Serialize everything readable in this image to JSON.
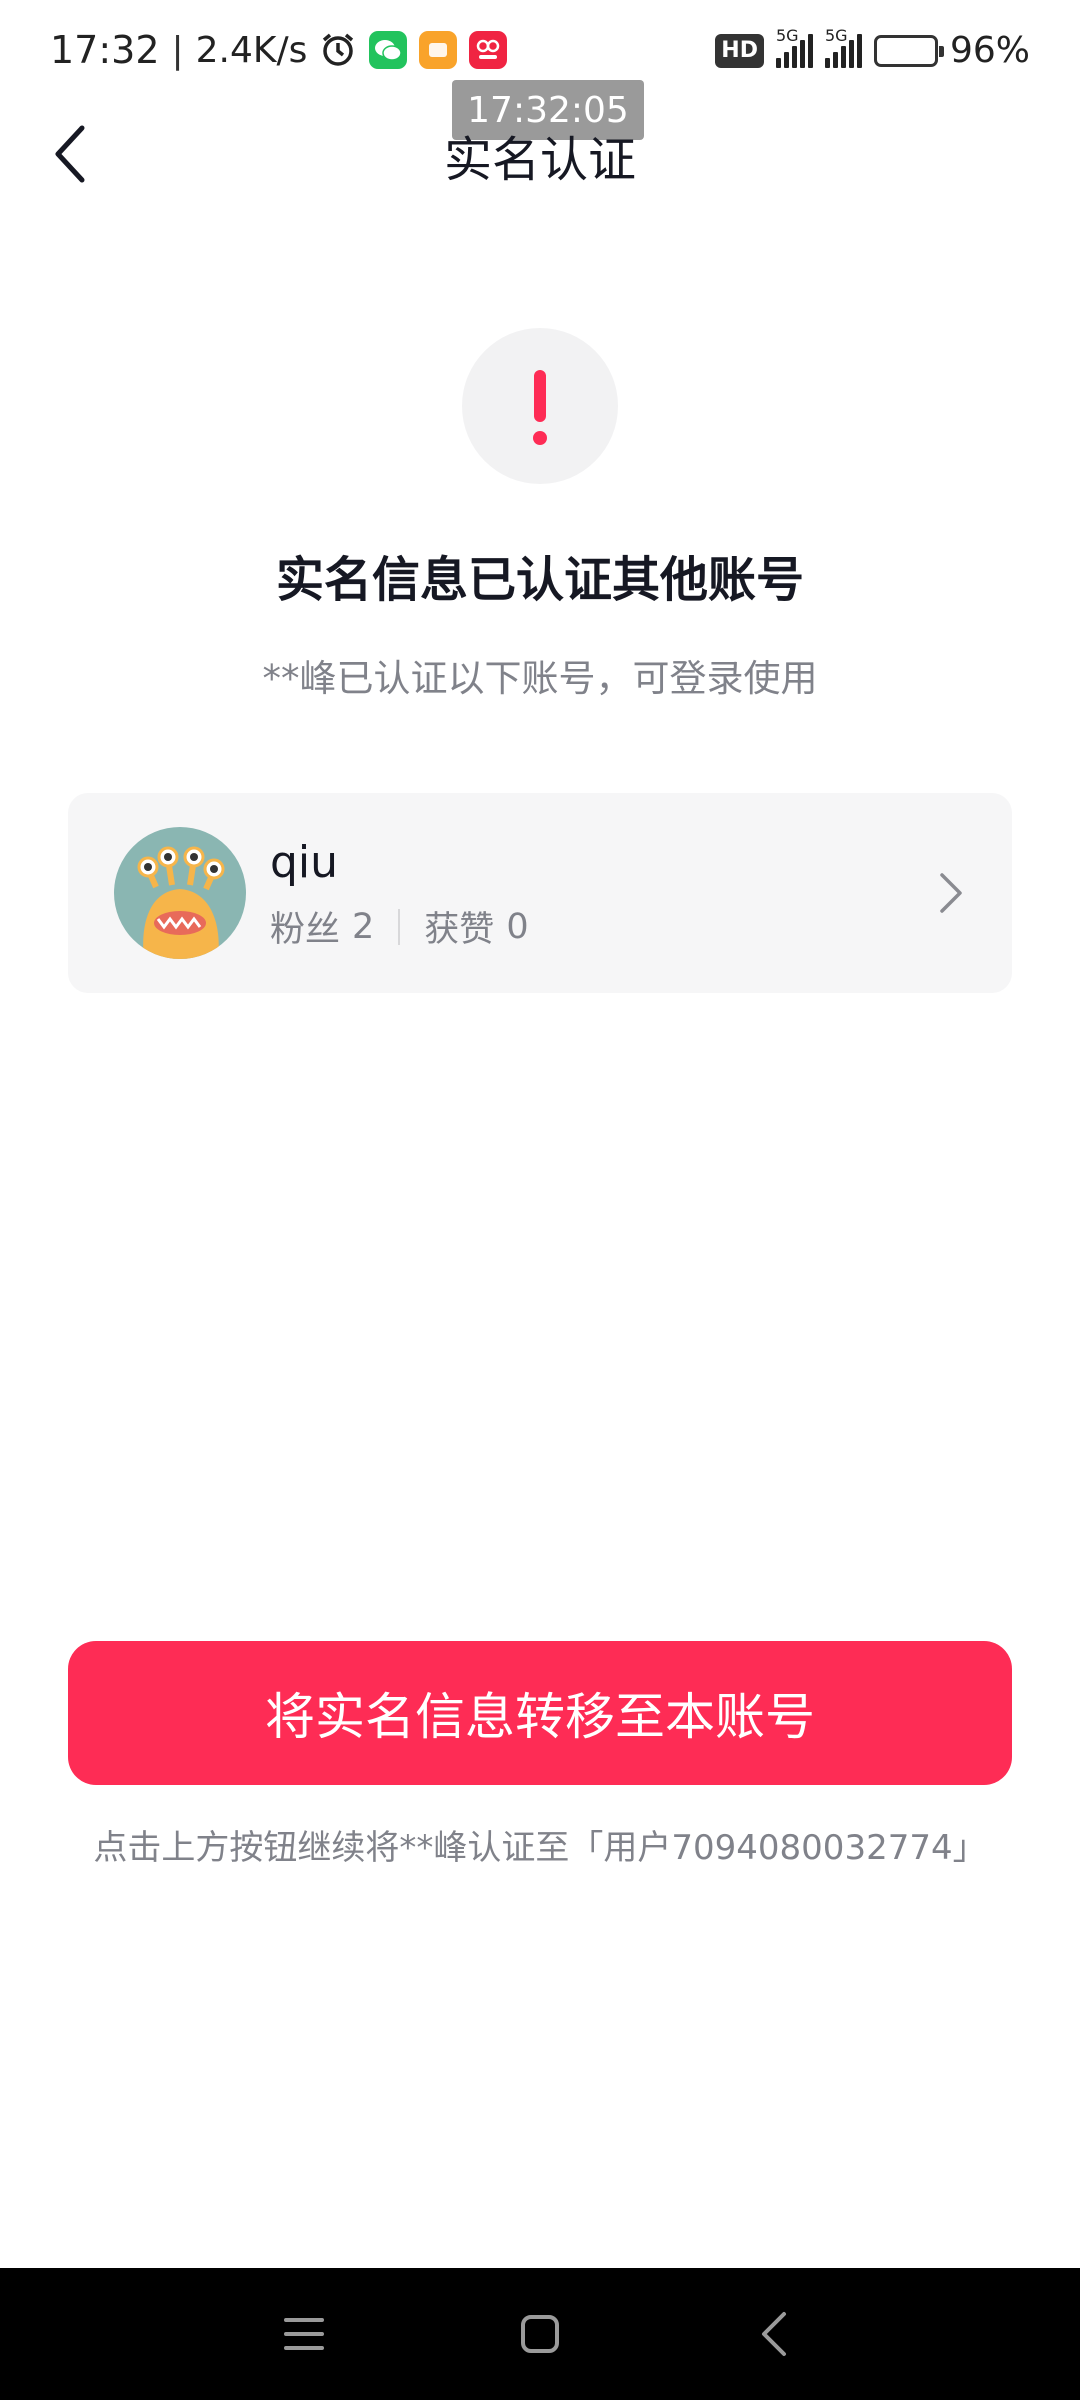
{
  "status_bar": {
    "time": "17:32",
    "divider": "|",
    "speed": "2.4K/s",
    "hd": "HD",
    "net1": "5G",
    "net2": "5G",
    "battery": "96%"
  },
  "overlay_time": "17:32:05",
  "nav": {
    "title": "实名认证"
  },
  "alert": {
    "headline": "实名信息已认证其他账号",
    "subline": "**峰已认证以下账号，可登录使用"
  },
  "account": {
    "name": "qiu",
    "fans_label": "粉丝",
    "fans_value": "2",
    "likes_label": "获赞",
    "likes_value": "0"
  },
  "primary_button": "将实名信息转移至本账号",
  "hint": "点击上方按钮继续将**峰认证至「用户7094080032774」",
  "colors": {
    "accent": "#fe2c55",
    "card_bg": "#f6f6f7",
    "secondary_text": "#80828a"
  }
}
